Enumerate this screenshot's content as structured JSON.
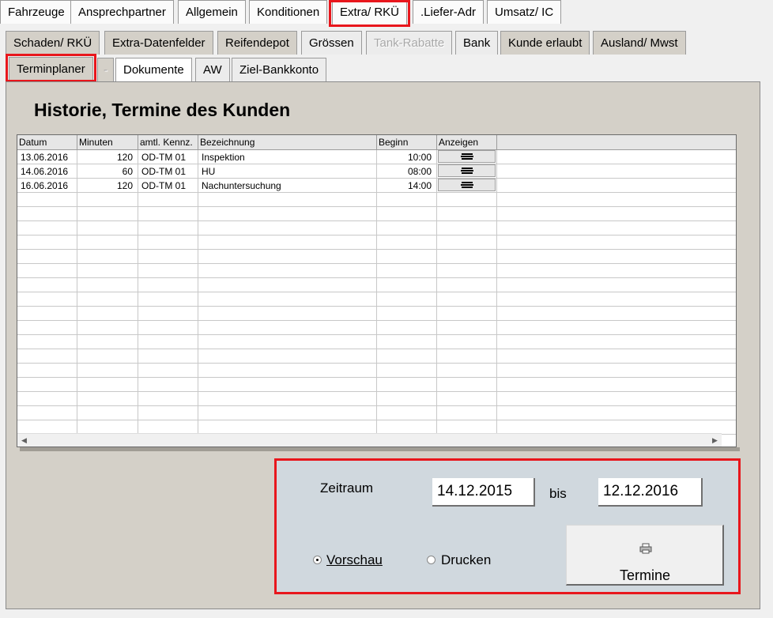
{
  "tabs_top": [
    {
      "label": "Fahrzeuge"
    },
    {
      "label": "Ansprechpartner"
    },
    {
      "label": "Allgemein"
    },
    {
      "label": "Konditionen"
    },
    {
      "label": "Extra/ RKÜ"
    },
    {
      "label": ".Liefer-Adr"
    },
    {
      "label": "Umsatz/ IC"
    }
  ],
  "tabs_sub": [
    {
      "label": "Schaden/ RKÜ"
    },
    {
      "label": "Extra-Datenfelder"
    },
    {
      "label": "Reifendepot"
    },
    {
      "label": "Grössen"
    },
    {
      "label": "Tank-Rabatte"
    },
    {
      "label": "Bank"
    },
    {
      "label": "Kunde erlaubt"
    },
    {
      "label": "Ausland/ Mwst"
    },
    {
      "label": "Terminplaner"
    },
    {
      "label": "-"
    },
    {
      "label": "Dokumente"
    },
    {
      "label": "AW"
    },
    {
      "label": "Ziel-Bankkonto"
    }
  ],
  "title": "Historie, Termine des Kunden",
  "grid": {
    "columns": [
      "Datum",
      "Minuten",
      "amtl. Kennz.",
      "Bezeichnung",
      "Beginn",
      "Anzeigen"
    ],
    "rows": [
      [
        "13.06.2016",
        "120",
        "OD-TM 01",
        "Inspektion",
        "10:00"
      ],
      [
        "14.06.2016",
        "60",
        "OD-TM 01",
        "HU",
        "08:00"
      ],
      [
        "16.06.2016",
        "120",
        "OD-TM 01",
        "Nachuntersuchung",
        "14:00"
      ]
    ],
    "show_button_icon": "list-icon"
  },
  "filter": {
    "zeitraum_label": "Zeitraum",
    "from_date": "14.12.2015",
    "bis_label": "bis",
    "to_date": "12.12.2016",
    "vorschau_label": "Vorschau",
    "drucken_label": "Drucken",
    "selected": "Vorschau",
    "button_label": "Termine",
    "button_icon": "printer-icon"
  },
  "colors": {
    "highlight": "#e8161c",
    "panel": "#d4d0c8",
    "filter_box": "#d0d8de"
  }
}
